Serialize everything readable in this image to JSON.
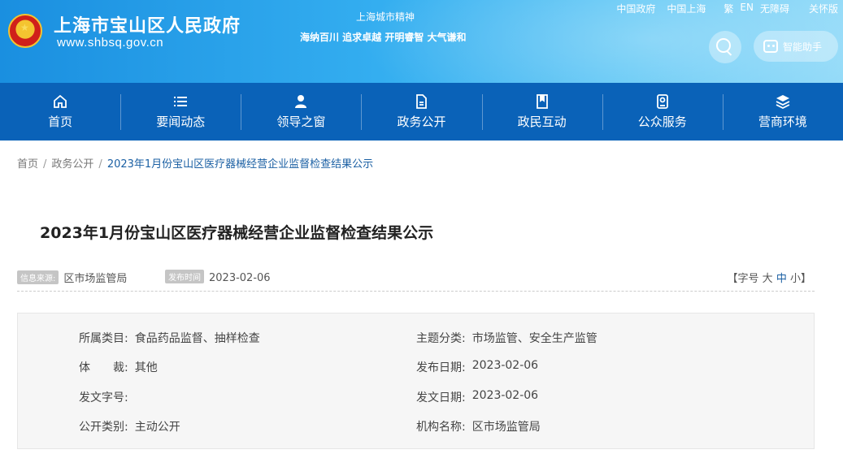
{
  "header": {
    "site_title": "上海市宝山区人民政府",
    "site_domain": "www.shbsq.gov.cn",
    "spirit_title": "上海城市精神",
    "spirit_text": "海纳百川 追求卓越 开明睿智 大气谦和",
    "top_links": [
      "中国政府",
      "中国上海",
      "繁",
      "EN",
      "无障碍",
      "关怀版"
    ],
    "assistant_label": "智能助手"
  },
  "nav": {
    "items": [
      {
        "label": "首页",
        "icon": "home-icon"
      },
      {
        "label": "要闻动态",
        "icon": "list-icon"
      },
      {
        "label": "领导之窗",
        "icon": "person-icon"
      },
      {
        "label": "政务公开",
        "icon": "document-icon"
      },
      {
        "label": "政民互动",
        "icon": "bookmark-icon"
      },
      {
        "label": "公众服务",
        "icon": "service-icon"
      },
      {
        "label": "营商环境",
        "icon": "layers-icon"
      }
    ]
  },
  "breadcrumb": {
    "home": "首页",
    "section": "政务公开",
    "current": "2023年1月份宝山区医疗器械经营企业监督检查结果公示"
  },
  "article": {
    "title": "2023年1月份宝山区医疗器械经营企业监督检查结果公示",
    "source_tag": "信息来源:",
    "source": "区市场监管局",
    "time_tag": "发布时间",
    "date": "2023-02-06",
    "fontsize": {
      "open": "【字号",
      "large": "大",
      "medium": "中",
      "small": "小】"
    }
  },
  "info": {
    "category_key": "所属类目:",
    "category_val": "食品药品监督、抽样检查",
    "topic_key": "主题分类:",
    "topic_val": "市场监管、安全生产监管",
    "genre_key": "体　　裁:",
    "genre_val": "其他",
    "pubdate_key": "发布日期:",
    "pubdate_val": "2023-02-06",
    "docno_key": "发文字号:",
    "docno_val": "",
    "issuedate_key": "发文日期:",
    "issuedate_val": "2023-02-06",
    "disclosure_key": "公开类别:",
    "disclosure_val": "主动公开",
    "org_key": "机构名称:",
    "org_val": "区市场监管局"
  },
  "colors": {
    "nav_bg": "#0a62b8",
    "accent": "#1a5fa3",
    "header_gradient_start": "#1a8fe0",
    "header_gradient_end": "#8fd9f8"
  }
}
